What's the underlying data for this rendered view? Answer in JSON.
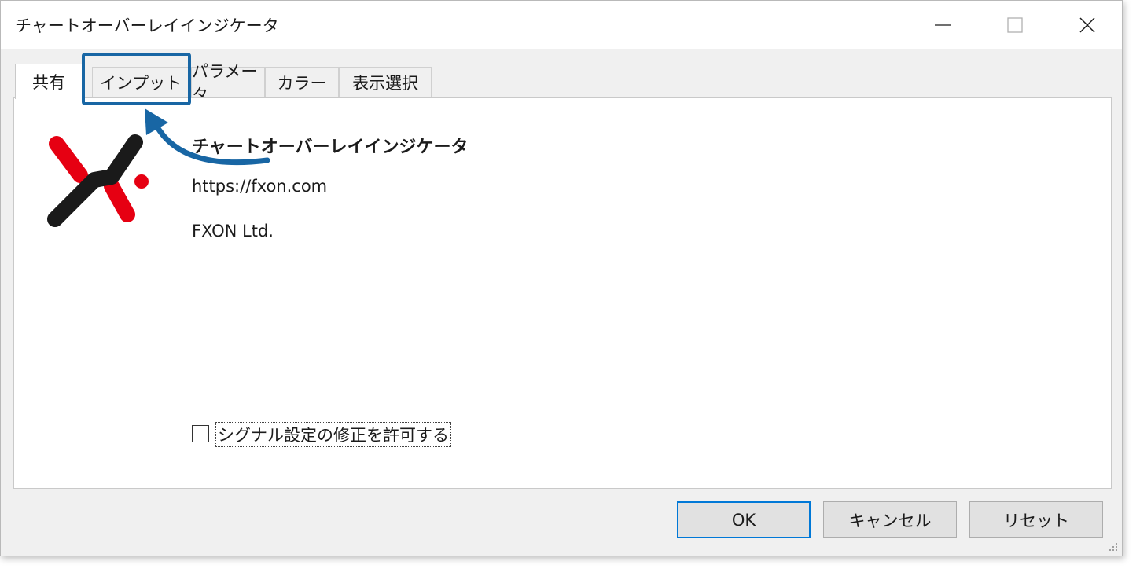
{
  "window": {
    "title": "チャートオーバーレイインジケータ"
  },
  "window_controls": {
    "minimize_icon": "minimize-icon",
    "maximize_icon": "maximize-icon",
    "close_icon": "close-icon"
  },
  "tabs": [
    {
      "label": "共有",
      "active": true
    },
    {
      "label": "インプット",
      "active": false,
      "highlighted": true
    },
    {
      "label": "パラメータ",
      "active": false
    },
    {
      "label": "カラー",
      "active": false
    },
    {
      "label": "表示選択",
      "active": false
    }
  ],
  "info": {
    "name": "チャートオーバーレイインジケータ",
    "url": "https://fxon.com",
    "company": "FXON Ltd."
  },
  "options": {
    "allow_signal_edit_label": "シグナル設定の修正を許可する",
    "allow_signal_edit_checked": false
  },
  "buttons": {
    "ok": "OK",
    "cancel": "キャンセル",
    "reset": "リセット"
  },
  "colors": {
    "highlight": "#1866a4",
    "logo_red": "#e60012",
    "logo_black": "#1a1a1a",
    "default_button_border": "#0078d7"
  }
}
